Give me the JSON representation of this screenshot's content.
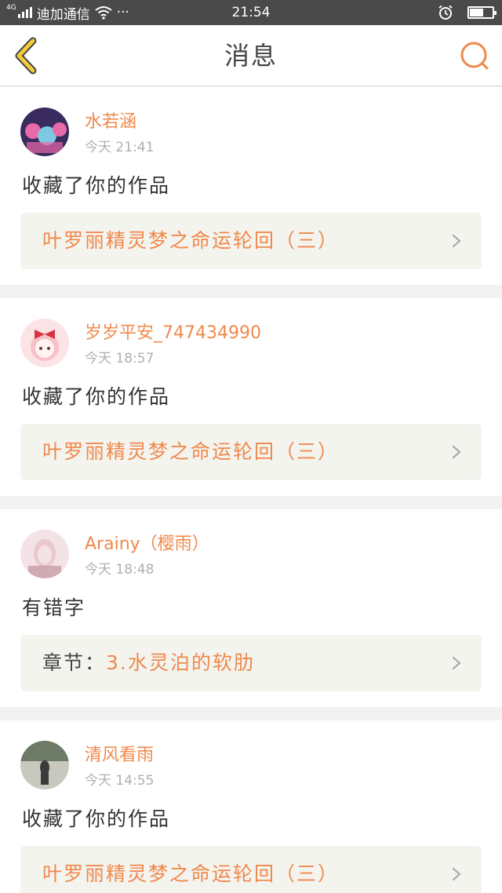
{
  "status_bar": {
    "network": "4G",
    "carrier": "迪加通信",
    "dots": "···",
    "time": "21:54",
    "battery_level": 0.6
  },
  "header": {
    "title": "消息",
    "accent_color": "#f0894c"
  },
  "messages": [
    {
      "username": "水若涵",
      "time": "今天 21:41",
      "action": "收藏了你的作品",
      "link_prefix": "",
      "link_text": "叶罗丽精灵梦之命运轮回（三）",
      "avatar_colors": [
        "#3a2b5e",
        "#e86aa8",
        "#7ec8e3"
      ]
    },
    {
      "username": "岁岁平安_747434990",
      "time": "今天 18:57",
      "action": "收藏了你的作品",
      "link_prefix": "",
      "link_text": "叶罗丽精灵梦之命运轮回（三）",
      "avatar_colors": [
        "#fbe3e6",
        "#d8323c",
        "#f7c1c8"
      ]
    },
    {
      "username": "Arainy（樱雨）",
      "time": "今天 18:48",
      "action": "有错字",
      "link_prefix": "章节：",
      "link_text": "3.水灵泊的软肋",
      "avatar_colors": [
        "#e9c9cf",
        "#b9868f",
        "#f4e3e6"
      ]
    },
    {
      "username": "清风看雨",
      "time": "今天 14:55",
      "action": "收藏了你的作品",
      "link_prefix": "",
      "link_text": "叶罗丽精灵梦之命运轮回（三）",
      "avatar_colors": [
        "#6d7a66",
        "#c9c8bf",
        "#3b3b3b"
      ]
    }
  ]
}
